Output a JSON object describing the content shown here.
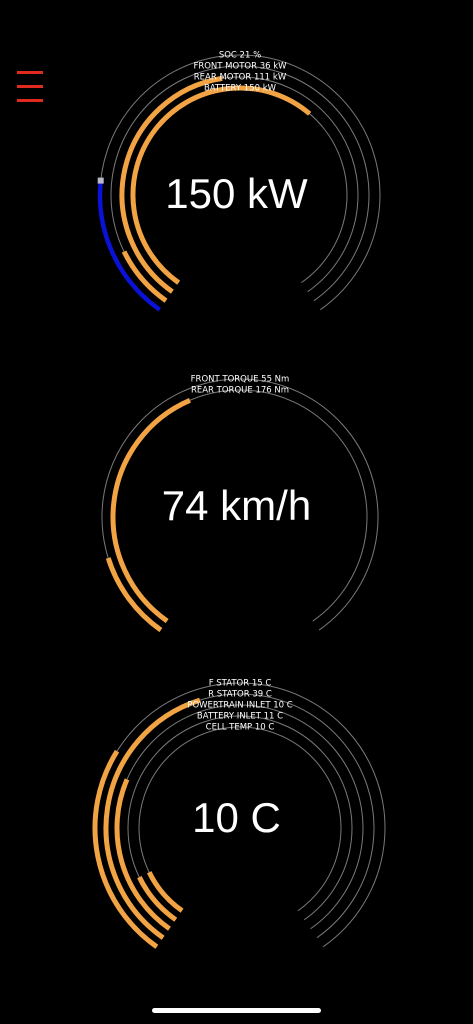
{
  "menu": {
    "icon": "hamburger-menu-icon"
  },
  "colors": {
    "fill": "#f2a445",
    "track": "#7a7a7a",
    "soc": "#0a12d8",
    "menu": "#e02a1f",
    "text": "#ffffff"
  },
  "power_gauge": {
    "value_text": "150 kW",
    "rings": [
      {
        "label": "SOC 21 %",
        "fraction": 0.21,
        "kind": "soc"
      },
      {
        "label": "FRONT MOTOR 36 kW",
        "fraction": 0.1,
        "kind": "power"
      },
      {
        "label": "REAR MOTOR 111 kW",
        "fraction": 0.47,
        "kind": "power"
      },
      {
        "label": "BATTERY 150 kW",
        "fraction": 0.64,
        "kind": "power"
      }
    ]
  },
  "speed_gauge": {
    "value_text": "74 km/h",
    "rings": [
      {
        "label": "FRONT TORQUE 55 Nm",
        "fraction": 0.13,
        "kind": "torque"
      },
      {
        "label": "REAR TORQUE 176 Nm",
        "fraction": 0.42,
        "kind": "torque"
      }
    ]
  },
  "temp_gauge": {
    "value_text": "10 C",
    "rings": [
      {
        "label": "F STATOR 15 C",
        "fraction": 0.3,
        "kind": "temp"
      },
      {
        "label": "R STATOR 39 C",
        "fraction": 0.44,
        "kind": "temp"
      },
      {
        "label": "POWERTRAIN INLET 10 C",
        "fraction": 0.27,
        "kind": "temp"
      },
      {
        "label": "BATTERY INLET 11 C",
        "fraction": 0.1,
        "kind": "temp"
      },
      {
        "label": "CELL TEMP 10 C",
        "fraction": 0.1,
        "kind": "temp"
      }
    ]
  }
}
